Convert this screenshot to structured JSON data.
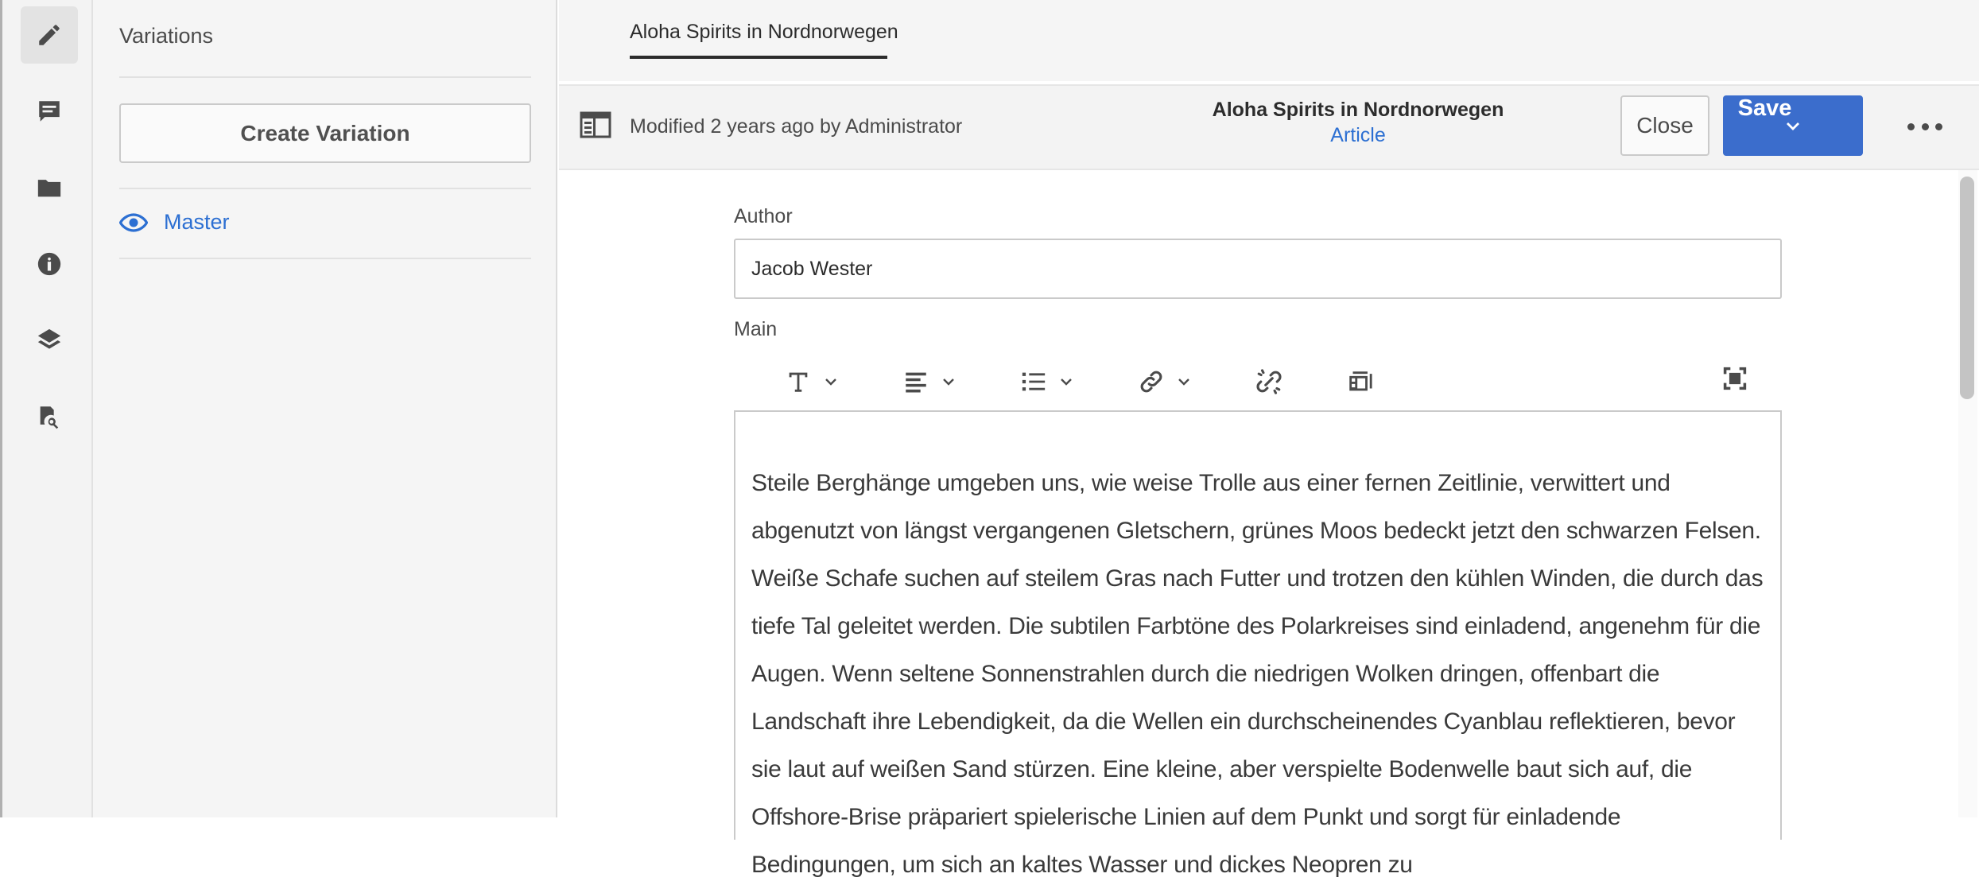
{
  "rail": {
    "items": [
      {
        "name": "edit",
        "icon": "pencil-icon"
      },
      {
        "name": "annotations",
        "icon": "comment-icon"
      },
      {
        "name": "assets",
        "icon": "folder-icon"
      },
      {
        "name": "metadata",
        "icon": "info-icon"
      },
      {
        "name": "structure",
        "icon": "layers-icon"
      },
      {
        "name": "references",
        "icon": "search-references-icon"
      }
    ]
  },
  "variations": {
    "title": "Variations",
    "create_label": "Create Variation",
    "master_label": "Master"
  },
  "tabs": [
    {
      "label": "Aloha Spirits in Nordnorwegen"
    }
  ],
  "header": {
    "modified": "Modified 2 years ago by Administrator",
    "title": "Aloha Spirits in Nordnorwegen",
    "model": "Article",
    "close_label": "Close",
    "save_label": "Save"
  },
  "form": {
    "author_label": "Author",
    "author_value": "Jacob Wester",
    "main_label": "Main",
    "main_text": "Steile Berghänge umgeben uns, wie weise Trolle aus einer fernen Zeitlinie, verwittert und abgenutzt von längst vergangenen Gletschern, grünes Moos bedeckt jetzt den schwarzen Felsen. Weiße Schafe suchen auf steilem Gras nach Futter und trotzen den kühlen Winden, die durch das tiefe Tal geleitet werden. Die subtilen Farbtöne des Polarkreises sind einladend, angenehm für die Augen. Wenn seltene Sonnenstrahlen durch die niedrigen Wolken dringen, offenbart die Landschaft ihre Lebendigkeit, da die Wellen ein durchscheinendes Cyanblau reflektieren, bevor sie laut auf weißen Sand stürzen. Eine kleine, aber verspielte Bodenwelle baut sich auf, die Offshore-Brise präpariert spielerische Linien auf dem Punkt und sorgt für einladende Bedingungen, um sich an kaltes Wasser und dickes Neopren zu"
  },
  "colors": {
    "accent": "#3b6dcc",
    "link": "#2c6fd2"
  }
}
